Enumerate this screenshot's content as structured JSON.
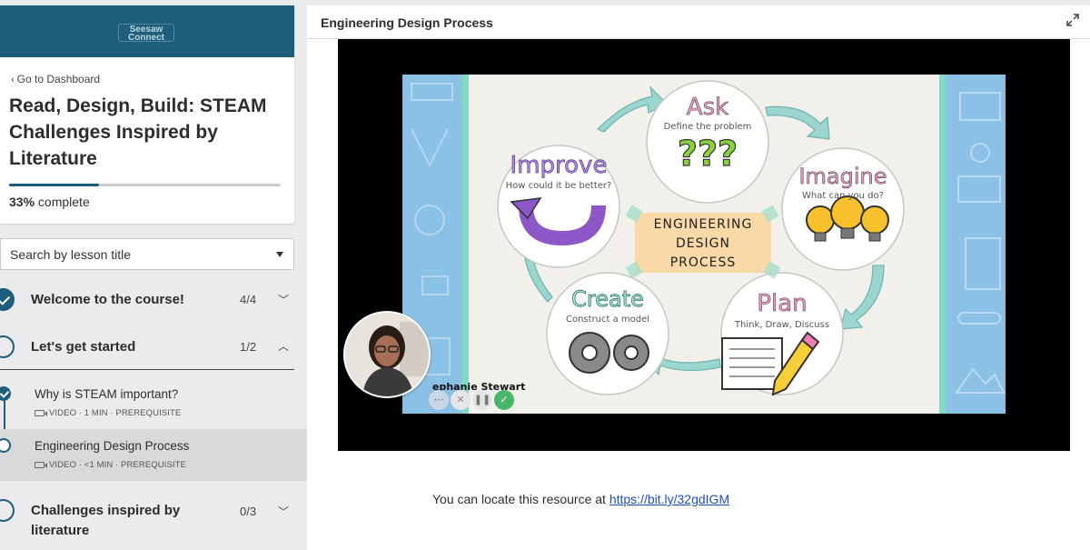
{
  "brand": {
    "logo_line1": "Seesaw",
    "logo_line2": "Connect",
    "color": "#1e5e7c"
  },
  "course": {
    "back_link": "Go to Dashboard",
    "title": "Read, Design, Build: STEAM Challenges Inspired by Literature",
    "progress_percent": 33,
    "progress_label": "33%",
    "progress_suffix": "complete"
  },
  "search": {
    "placeholder": "Search by lesson title"
  },
  "sections": [
    {
      "title": "Welcome to the course!",
      "count": "4/4",
      "expanded": false,
      "completed": true
    },
    {
      "title": "Let's get started",
      "count": "1/2",
      "expanded": true,
      "completed": false,
      "lessons": [
        {
          "title": "Why is STEAM important?",
          "meta": "VIDEO · 1 MIN · PREREQUISITE",
          "completed": true,
          "active": false
        },
        {
          "title": "Engineering Design Process",
          "meta": "VIDEO · <1 MIN · PREREQUISITE",
          "completed": false,
          "active": true
        }
      ]
    },
    {
      "title": "Challenges inspired by literature",
      "count": "0/3",
      "expanded": false,
      "completed": false
    }
  ],
  "main": {
    "heading": "Engineering Design Process",
    "expand_icon": "expand-icon",
    "resource_prefix": "You can locate this resource at",
    "resource_link": "https://bit.ly/32gdIGM"
  },
  "slide": {
    "ask_title": "Ask",
    "ask_sub": "Define the problem",
    "ask_symbol": "???",
    "imagine_title": "Imagine",
    "imagine_sub": "What can you do?",
    "plan_title": "Plan",
    "plan_sub": "Think, Draw, Discuss",
    "create_title": "Create",
    "create_sub": "Construct a model",
    "improve_title": "Improve",
    "improve_sub": "How could it be better?",
    "center_line1": "ENGINEERING",
    "center_line2": "DESIGN",
    "center_line3": "PROCESS"
  },
  "presenter": {
    "name": "ephanie Stewart"
  }
}
